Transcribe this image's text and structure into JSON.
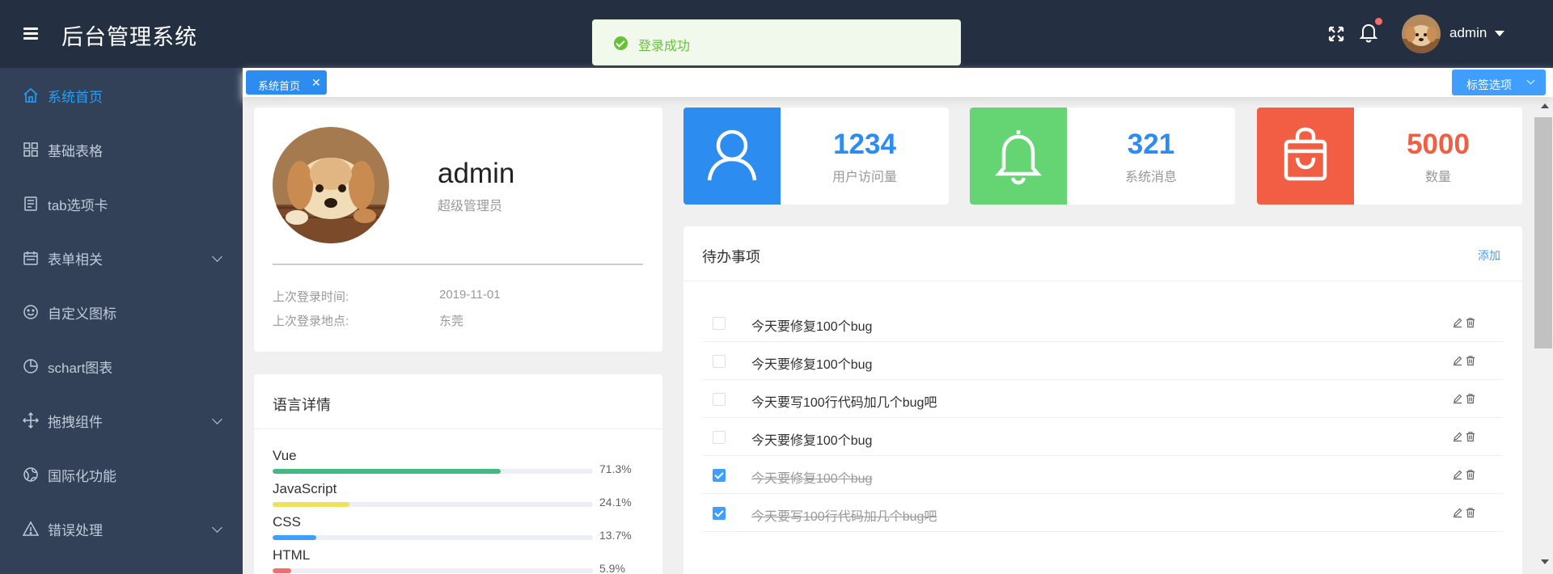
{
  "header": {
    "title": "后台管理系统",
    "username": "admin"
  },
  "toast": {
    "message": "登录成功"
  },
  "sidebar": {
    "items": [
      {
        "label": "系统首页",
        "icon": "home-icon",
        "active": true
      },
      {
        "label": "基础表格",
        "icon": "grid-icon"
      },
      {
        "label": "tab选项卡",
        "icon": "document-icon"
      },
      {
        "label": "表单相关",
        "icon": "calendar-icon",
        "expandable": true
      },
      {
        "label": "自定义图标",
        "icon": "smiley-icon"
      },
      {
        "label": "schart图表",
        "icon": "pie-chart-icon"
      },
      {
        "label": "拖拽组件",
        "icon": "move-icon",
        "expandable": true
      },
      {
        "label": "国际化功能",
        "icon": "globe-icon"
      },
      {
        "label": "错误处理",
        "icon": "warning-icon",
        "expandable": true
      }
    ]
  },
  "tags": {
    "items": [
      {
        "label": "系统首页"
      }
    ],
    "options_label": "标签选项"
  },
  "profile": {
    "name": "admin",
    "role": "超级管理员",
    "last_login_time_label": "上次登录时间:",
    "last_login_time": "2019-11-01",
    "last_login_place_label": "上次登录地点:",
    "last_login_place": "东莞"
  },
  "languages": {
    "title": "语言详情",
    "items": [
      {
        "name": "Vue",
        "percent": 71.3,
        "percent_text": "71.3%",
        "color": "#42b983"
      },
      {
        "name": "JavaScript",
        "percent": 24.1,
        "percent_text": "24.1%",
        "color": "#f1e05a"
      },
      {
        "name": "CSS",
        "percent": 13.7,
        "percent_text": "13.7%",
        "color": "#409eff"
      },
      {
        "name": "HTML",
        "percent": 5.9,
        "percent_text": "5.9%",
        "color": "#f56c6c"
      }
    ]
  },
  "stats": [
    {
      "value": "1234",
      "label": "用户访问量",
      "color": "#2d8cf0",
      "icon": "user-icon"
    },
    {
      "value": "321",
      "label": "系统消息",
      "color": "#64d572",
      "icon": "bell-icon",
      "value_color": "#2d8cf0"
    },
    {
      "value": "5000",
      "label": "数量",
      "color": "#f25e43",
      "icon": "shopping-bag-icon"
    }
  ],
  "todo": {
    "title": "待办事项",
    "add_label": "添加",
    "items": [
      {
        "title": "今天要修复100个bug",
        "done": false
      },
      {
        "title": "今天要修复100个bug",
        "done": false
      },
      {
        "title": "今天要写100行代码加几个bug吧",
        "done": false
      },
      {
        "title": "今天要修复100个bug",
        "done": false
      },
      {
        "title": "今天要修复100个bug",
        "done": true
      },
      {
        "title": "今天要写100行代码加几个bug吧",
        "done": true
      }
    ]
  }
}
